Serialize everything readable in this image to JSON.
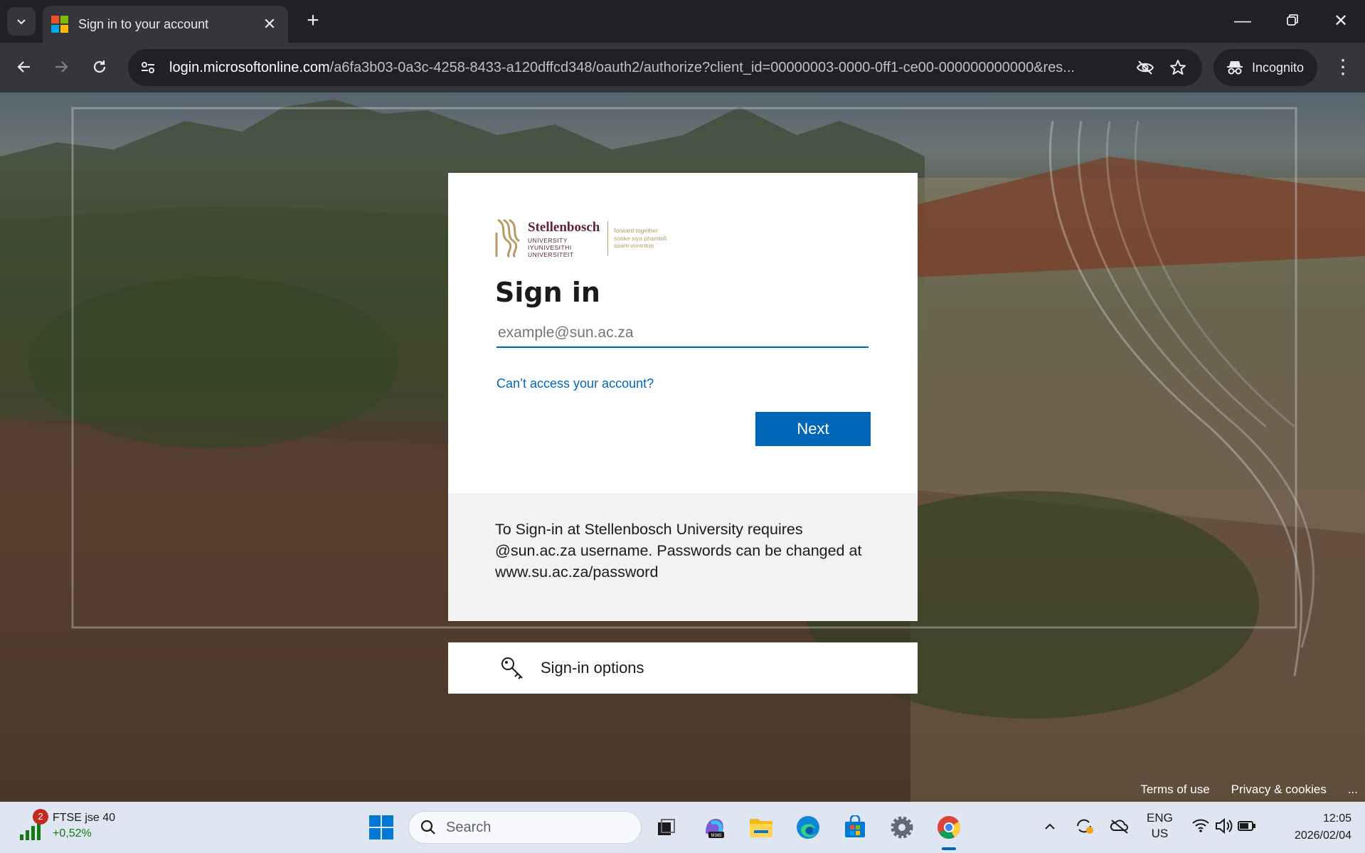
{
  "browser": {
    "tab_title": "Sign in to your account",
    "url_domain": "login.microsoftonline.com",
    "url_rest": "/a6fa3b03-0a3c-4258-8433-a120dffcd348/oauth2/authorize?client_id=00000003-0000-0ff1-ce00-000000000000&res...",
    "incognito_label": "Incognito"
  },
  "logo": {
    "name": "Stellenbosch",
    "university_lines": "UNIVERSITY\nIYUNIVESITHI\nUNIVERSITEIT",
    "motto": "forward together\nsonke siya phambili\nsaam vorentoe"
  },
  "signin": {
    "title": "Sign in",
    "email_placeholder": "example@sun.ac.za",
    "cant_access": "Can’t access your account?",
    "next_label": "Next",
    "notice": "To Sign-in at Stellenbosch University requires @sun.ac.za username. Passwords can be changed at www.su.ac.za/password",
    "options_label": "Sign-in options"
  },
  "footer": {
    "terms": "Terms of use",
    "privacy": "Privacy & cookies",
    "more": "..."
  },
  "taskbar": {
    "widget_badge": "2",
    "widget_title": "FTSE jse 40",
    "widget_change": "+0,52%",
    "search_placeholder": "Search",
    "lang_line1": "ENG",
    "lang_line2": "US",
    "time": "12:05",
    "date": "2026/02/04"
  },
  "colors": {
    "accent": "#0067b8",
    "brand": "#61223b"
  }
}
